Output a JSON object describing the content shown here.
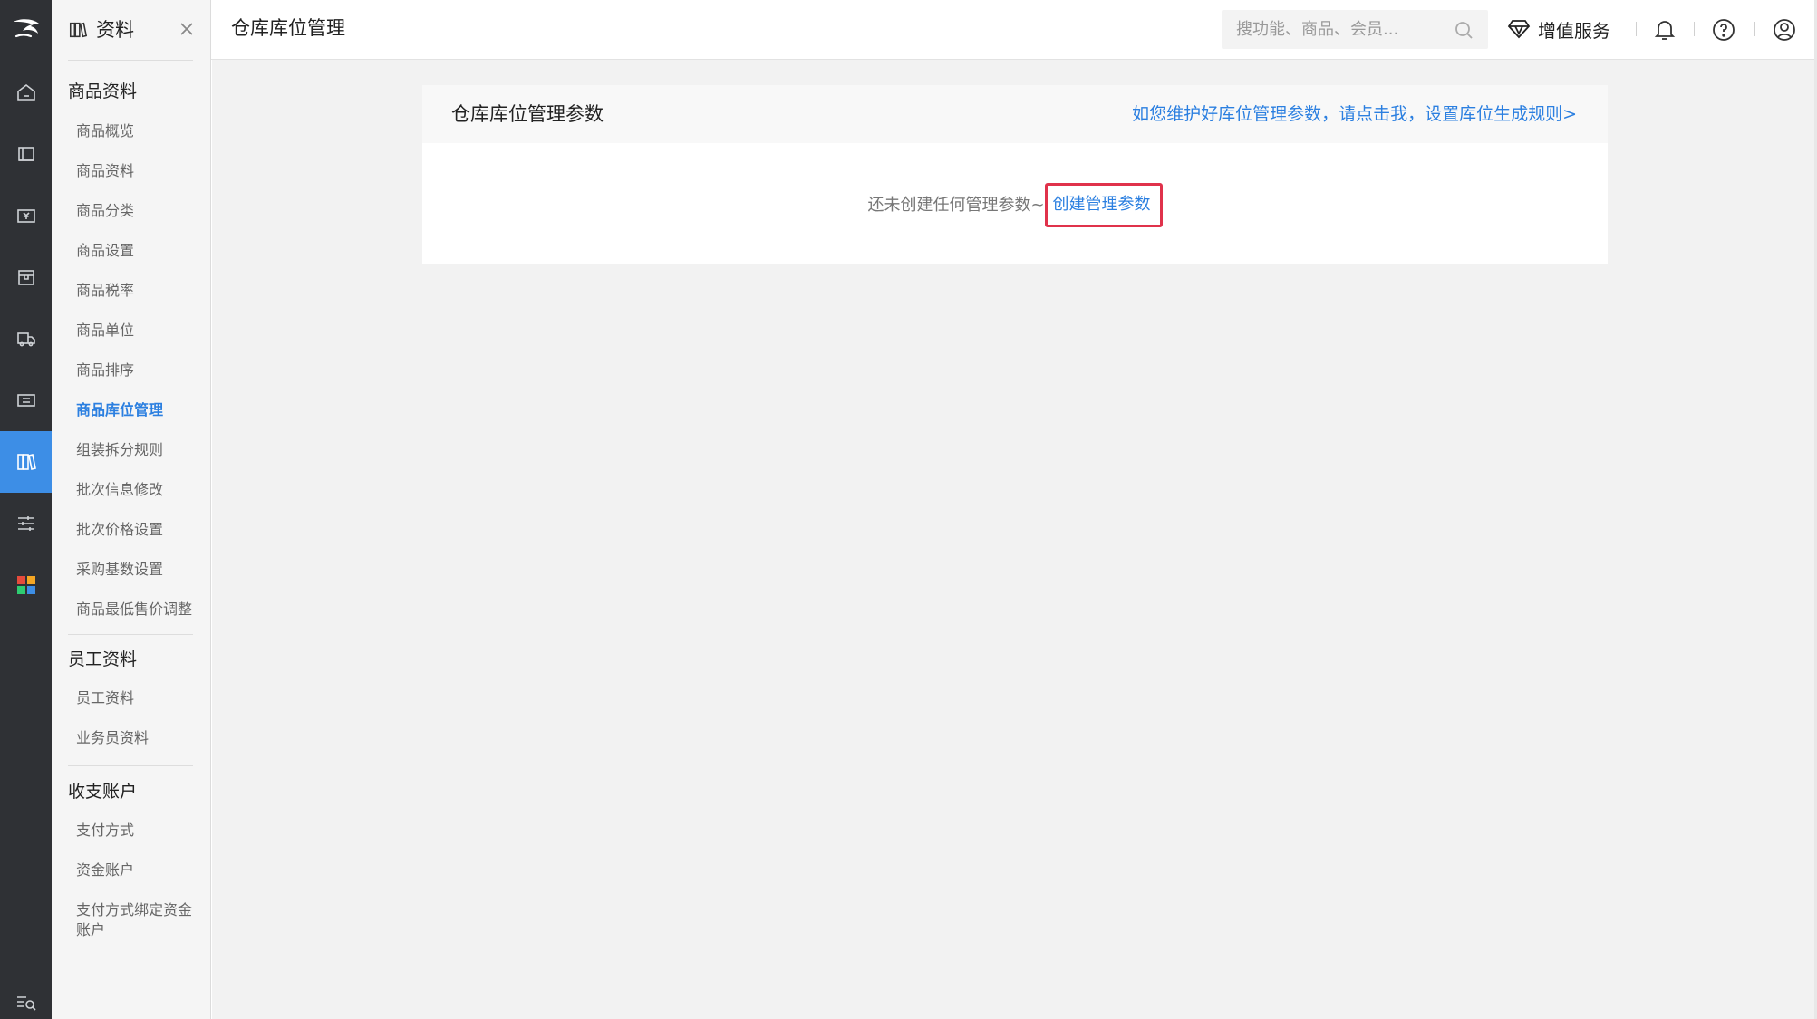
{
  "rail": {
    "items": [
      {
        "icon": "home-icon"
      },
      {
        "icon": "book-icon"
      },
      {
        "icon": "yen-card-icon"
      },
      {
        "icon": "box-icon"
      },
      {
        "icon": "truck-icon"
      },
      {
        "icon": "ticket-icon"
      },
      {
        "icon": "library-icon",
        "active": true
      },
      {
        "icon": "sliders-icon"
      },
      {
        "icon": "apps-grid-icon"
      }
    ],
    "bottom_icon": "menu-search-icon",
    "active_color": "#3d8ee6"
  },
  "submenu": {
    "title": "资料",
    "groups": [
      {
        "title": "商品资料",
        "items": [
          "商品概览",
          "商品资料",
          "商品分类",
          "商品设置",
          "商品税率",
          "商品单位",
          "商品排序",
          "商品库位管理",
          "组装拆分规则",
          "批次信息修改",
          "批次价格设置",
          "采购基数设置",
          "商品最低售价调整"
        ]
      },
      {
        "title": "员工资料",
        "items": [
          "员工资料",
          "业务员资料"
        ]
      },
      {
        "title": "收支账户",
        "items": [
          "支付方式",
          "资金账户",
          "支付方式绑定资金账户"
        ]
      }
    ],
    "active_item": "商品库位管理"
  },
  "topbar": {
    "page_title": "仓库库位管理",
    "search_placeholder": "搜功能、商品、会员...",
    "value_added_service": "增值服务"
  },
  "card": {
    "title": "仓库库位管理参数",
    "help_link": "如您维护好库位管理参数，请点击我，设置库位生成规则>",
    "empty_message": "还未创建任何管理参数~",
    "create_link": "创建管理参数"
  },
  "colors": {
    "link": "#2b7fe0",
    "highlight_border": "#e0324b",
    "rail_bg": "#2f3135"
  }
}
